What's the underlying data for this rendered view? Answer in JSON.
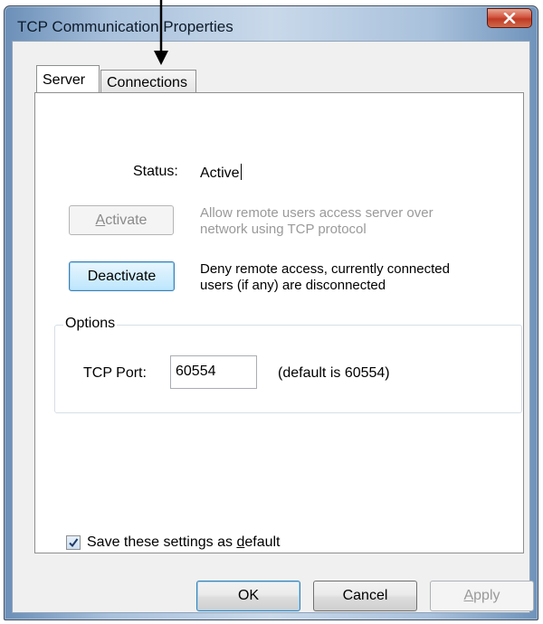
{
  "window": {
    "title": "TCP Communication Properties",
    "close_glyph": "x"
  },
  "tabs": [
    {
      "label": "Server",
      "selected": true
    },
    {
      "label": "Connections",
      "selected": false
    }
  ],
  "server": {
    "status_label": "Status:",
    "status_value": "Active",
    "activate_label_rest": "ctivate",
    "activate_label_mnemonic": "A",
    "activate_description_line1": "Allow remote users access server over",
    "activate_description_line2": "network using TCP protocol",
    "deactivate_label": "Deactivate",
    "deactivate_description_line1": "Deny remote access, currently connected",
    "deactivate_description_line2": "users (if any) are disconnected"
  },
  "options": {
    "group_title": "Options",
    "port_label": "TCP Port:",
    "port_value": "60554",
    "port_hint": "(default is 60554)"
  },
  "save_default": {
    "checked": true,
    "label_prefix": "Save these settings as ",
    "label_mnemonic": "d",
    "label_suffix": "efault"
  },
  "footer": {
    "ok_label": "OK",
    "cancel_label": "Cancel",
    "apply_mnemonic": "A",
    "apply_rest": "pply"
  },
  "colors": {
    "close_button": "#c9452f",
    "focus_border": "#3c7fb1",
    "disabled_text": "#9a9a9a"
  },
  "icons": {
    "close": "close-icon",
    "check": "checkmark-icon",
    "annotation": "down-arrow-icon"
  }
}
